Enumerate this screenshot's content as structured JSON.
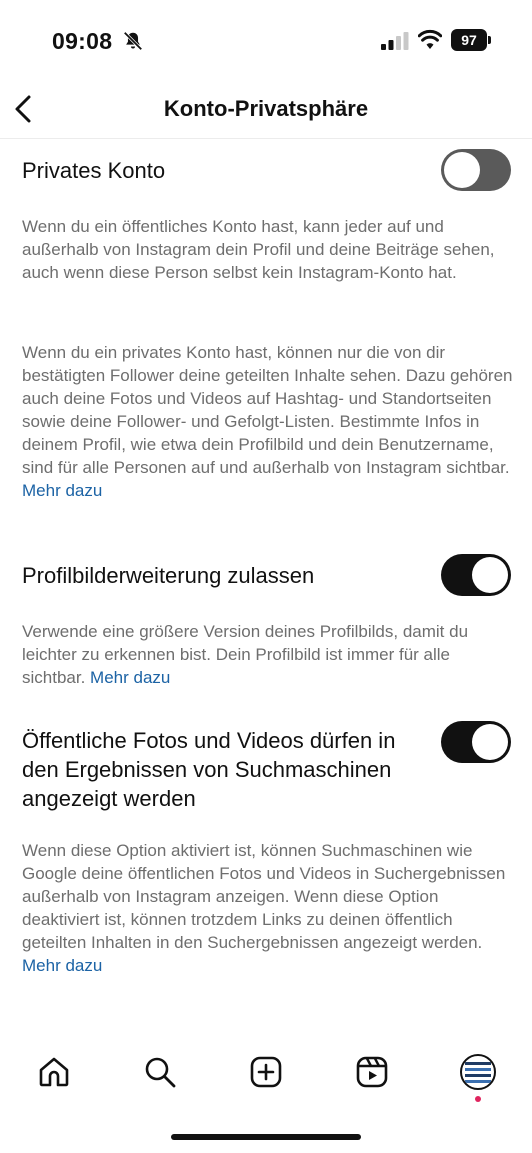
{
  "status_bar": {
    "time": "09:08",
    "battery": "97",
    "icons": [
      "bell-slash-icon",
      "cellular-signal-icon",
      "wifi-icon",
      "battery-icon"
    ]
  },
  "header": {
    "title": "Konto-Privatsphäre",
    "back_icon": "chevron-left-icon"
  },
  "settings": [
    {
      "label": "Privates Konto",
      "enabled": false,
      "paragraphs": [
        "Wenn du ein öffentliches Konto hast, kann jeder auf und außerhalb von Instagram dein Profil und deine Beiträge sehen, auch wenn diese Person selbst kein Instagram-Konto hat.",
        "Wenn du ein privates Konto hast, können nur die von dir bestätigten Follower deine geteilten Inhalte sehen. Dazu gehören auch deine Fotos und Videos auf Hashtag- und Standortseiten sowie deine Follower- und Gefolgt-Listen. Bestimmte Infos in deinem Profil, wie etwa dein Profilbild und dein Benutzername, sind für alle Personen auf und außerhalb von Instagram sichtbar."
      ],
      "link": "Mehr dazu"
    },
    {
      "label": "Profilbilderweiterung zulassen",
      "enabled": true,
      "description": "Verwende eine größere Version deines Profilbilds, damit du leichter zu erkennen bist. Dein Profilbild ist immer für alle sichtbar.",
      "link": "Mehr dazu"
    },
    {
      "label": "Öffentliche Fotos und Videos dürfen in den Ergebnissen von Suchmaschinen angezeigt werden",
      "enabled": true,
      "description": "Wenn diese Option aktiviert ist, können Suchmaschinen wie Google deine öffentlichen Fotos und Videos in Suchergebnissen außerhalb von Instagram anzeigen. Wenn diese Option deaktiviert ist, können trotzdem Links zu deinen öffentlich geteilten Inhalten in den Suchergebnissen angezeigt werden.",
      "link": "Mehr dazu"
    }
  ],
  "tab_bar": {
    "tabs": [
      "home-icon",
      "search-icon",
      "create-icon",
      "reels-icon",
      "profile-avatar"
    ]
  },
  "colors": {
    "link": "#1c63a5",
    "toggle_on": "#111111",
    "toggle_off": "#5a5a5a",
    "description_text": "#6e6e6e",
    "notification_dot": "#e0245e"
  }
}
